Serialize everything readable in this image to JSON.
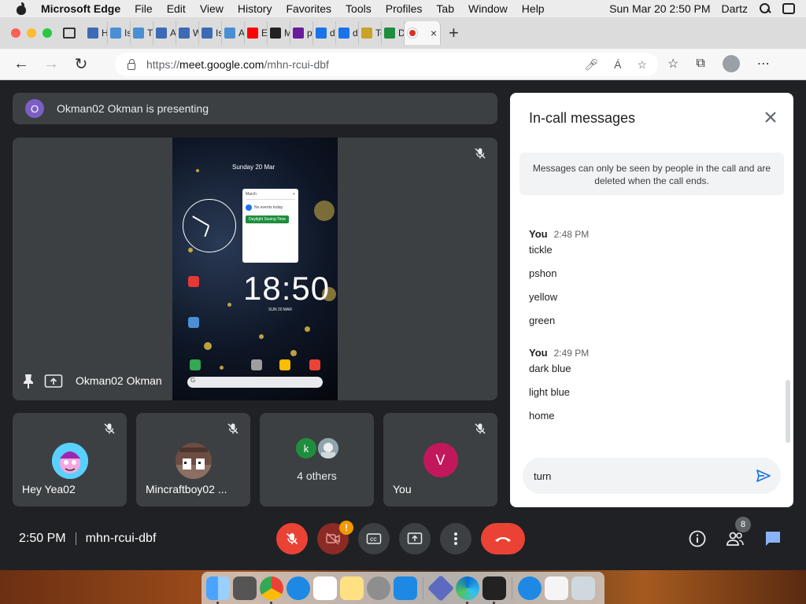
{
  "menubar": {
    "app": "Microsoft Edge",
    "items": [
      "File",
      "Edit",
      "View",
      "History",
      "Favorites",
      "Tools",
      "Profiles",
      "Tab",
      "Window",
      "Help"
    ],
    "datetime": "Sun Mar 20  2:50 PM",
    "user": "Dartz"
  },
  "tabs": [
    {
      "label": "Hor",
      "icon": "jw-icon",
      "color": "#3b6bb5"
    },
    {
      "label": "Is t",
      "icon": "page-icon",
      "color": "#4a8fd4"
    },
    {
      "label": "The",
      "icon": "page-icon",
      "color": "#4a8fd4"
    },
    {
      "label": "Am",
      "icon": "jw-icon",
      "color": "#3b6bb5"
    },
    {
      "label": "Wh",
      "icon": "jw-icon",
      "color": "#3b6bb5"
    },
    {
      "label": "Is H",
      "icon": "jw-icon",
      "color": "#3b6bb5"
    },
    {
      "label": "An",
      "icon": "page-icon",
      "color": "#4a8fd4"
    },
    {
      "label": "Edi",
      "icon": "youtube-icon",
      "color": "#ff0000"
    },
    {
      "label": "Ma",
      "icon": "x-logo-icon",
      "color": "#222222"
    },
    {
      "label": "pw",
      "icon": "hash-icon",
      "color": "#6a1b9a"
    },
    {
      "label": "dov",
      "icon": "bing-icon",
      "color": "#1a73e8"
    },
    {
      "label": "dov",
      "icon": "bing-icon",
      "color": "#1a73e8"
    },
    {
      "label": "Top",
      "icon": "p-icon",
      "color": "#c9a227"
    },
    {
      "label": "Dov",
      "icon": "dot-icon",
      "color": "#1e8e3e"
    }
  ],
  "active_tab": {
    "icon": "record-icon",
    "close": "×"
  },
  "address": {
    "scheme": "https://",
    "host": "meet.google.com",
    "path": "/mhn-rcui-dbf"
  },
  "meet": {
    "presenting_initial": "O",
    "presenting_text": "Okman02 Okman is presenting",
    "presenter_name": "Okman02 Okman",
    "phone": {
      "date": "Sunday 20 Mar",
      "widget_month": "March",
      "widget_event_none": "No events today",
      "widget_pill": "Daylight Saving Time",
      "big_time": "18:50",
      "sub_date": "SUN 20 MAR"
    },
    "tiles": [
      {
        "name": "Hey Yea02"
      },
      {
        "name": "Mincraftboy02 ..."
      },
      {
        "name": "4 others",
        "mini_initial": "k"
      },
      {
        "name": "You",
        "initial": "V"
      }
    ]
  },
  "chat": {
    "title": "In-call messages",
    "notice": "Messages can only be seen by people in the call and are deleted when the call ends.",
    "groups": [
      {
        "sender": "You",
        "time": "2:48 PM",
        "messages": [
          "tickle",
          "pshon",
          "yellow",
          "green"
        ]
      },
      {
        "sender": "You",
        "time": "2:49 PM",
        "messages": [
          "dark blue",
          "light blue",
          "home"
        ]
      }
    ],
    "compose_value": "turn",
    "colors": {
      "send": "#1a73e8"
    }
  },
  "bottom": {
    "time": "2:50 PM",
    "code": "mhn-rcui-dbf",
    "warning": "!",
    "participants_badge": "8"
  }
}
